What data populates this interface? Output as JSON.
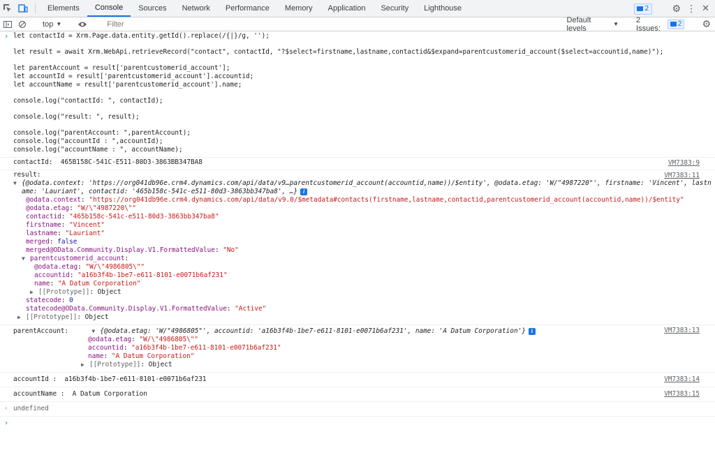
{
  "tabs": [
    {
      "label": "Elements"
    },
    {
      "label": "Console"
    },
    {
      "label": "Sources"
    },
    {
      "label": "Network"
    },
    {
      "label": "Performance"
    },
    {
      "label": "Memory"
    },
    {
      "label": "Application"
    },
    {
      "label": "Security"
    },
    {
      "label": "Lighthouse"
    }
  ],
  "topbar": {
    "messages_count": "2",
    "accent": "#1a73e8"
  },
  "toolbar": {
    "context": "top",
    "filter_placeholder": "Filter",
    "levels": "Default levels",
    "issues_label": "2 Issues:",
    "issues_count": "2"
  },
  "input_code": [
    "let contactId = Xrm.Page.data.entity.getId().replace(/{|}/g, '');",
    "",
    "let result = await Xrm.WebApi.retrieveRecord(\"contact\", contactId, \"?$select=firstname,lastname,contactid&$expand=parentcustomerid_account($select=accountid,name)\");",
    "",
    "let parentAccount = result['parentcustomerid_account'];",
    "let accountId = result['parentcustomerid_account'].accountid;",
    "let accountName = result['parentcustomerid_account'].name;",
    "",
    "console.log(\"contactId: \", contactId);",
    "",
    "console.log(\"result: \", result);",
    "",
    "console.log(\"parentAccount: \",parentAccount);",
    "console.log(\"accountId : \",accountId);",
    "console.log(\"accountName : \", accountName);"
  ],
  "log_contactId": {
    "label": "contactId:  ",
    "value": "465B158C-541C-E511-80D3-3863BB347BA8",
    "source": "VM7383:9"
  },
  "log_result": {
    "label": "result:",
    "source": "VM7383:11",
    "summary_1": "{@odata.context: 'https://org041db96e.crm4.dynamics.com/api/data/v9…parentcustomerid_account(accountid,name))/$entity', @odata.etag: 'W/\"4987220\"', firstname: 'Vincent', lastn",
    "summary_2": "ame: 'Lauriant', contactid: '465b158c-541c-e511-80d3-3863bb347ba8', …}",
    "props": [
      {
        "key": "@odata.context",
        "value": "\"https://org041db96e.crm4.dynamics.com/api/data/v9.0/$metadata#contacts(firstname,lastname,contactid,parentcustomerid_account(accountid,name))/$entity\"",
        "type": "str"
      },
      {
        "key": "@odata.etag",
        "value": "\"W/\\\"4987220\\\"\"",
        "type": "str"
      },
      {
        "key": "contactid",
        "value": "\"465b158c-541c-e511-80d3-3863bb347ba8\"",
        "type": "str"
      },
      {
        "key": "firstname",
        "value": "\"Vincent\"",
        "type": "str"
      },
      {
        "key": "lastname",
        "value": "\"Lauriant\"",
        "type": "str"
      },
      {
        "key": "merged",
        "value": "false",
        "type": "num"
      },
      {
        "key": "merged@OData.Community.Display.V1.FormattedValue",
        "value": "\"No\"",
        "type": "str"
      }
    ],
    "nested_key": "parentcustomerid_account",
    "nested_props": [
      {
        "key": "@odata.etag",
        "value": "\"W/\\\"4986805\\\"\"",
        "type": "str"
      },
      {
        "key": "accountid",
        "value": "\"a16b3f4b-1be7-e611-8101-e0071b6af231\"",
        "type": "str"
      },
      {
        "key": "name",
        "value": "\"A Datum Corporation\"",
        "type": "str"
      }
    ],
    "prototype": "[[Prototype]]",
    "prototype_value": "Object",
    "after_props": [
      {
        "key": "statecode",
        "value": "0",
        "type": "num"
      },
      {
        "key": "statecode@OData.Community.Display.V1.FormattedValue",
        "value": "\"Active\"",
        "type": "str"
      }
    ]
  },
  "log_parentAccount": {
    "label": "parentAccount:  ",
    "source": "VM7383:13",
    "summary": "{@odata.etag: 'W/\"4986805\"', accountid: 'a16b3f4b-1be7-e611-8101-e0071b6af231', name: 'A Datum Corporation'}",
    "props": [
      {
        "key": "@odata.etag",
        "value": "\"W/\\\"4986805\\\"\"",
        "type": "str"
      },
      {
        "key": "accountid",
        "value": "\"a16b3f4b-1be7-e611-8101-e0071b6af231\"",
        "type": "str"
      },
      {
        "key": "name",
        "value": "\"A Datum Corporation\"",
        "type": "str"
      }
    ]
  },
  "log_accountId": {
    "label": "accountId :  ",
    "value": "a16b3f4b-1be7-e611-8101-e0071b6af231",
    "source": "VM7383:14"
  },
  "log_accountName": {
    "label": "accountName :  ",
    "value": "A Datum Corporation",
    "source": "VM7383:15"
  },
  "return_value": "undefined",
  "info_glyph": "i"
}
